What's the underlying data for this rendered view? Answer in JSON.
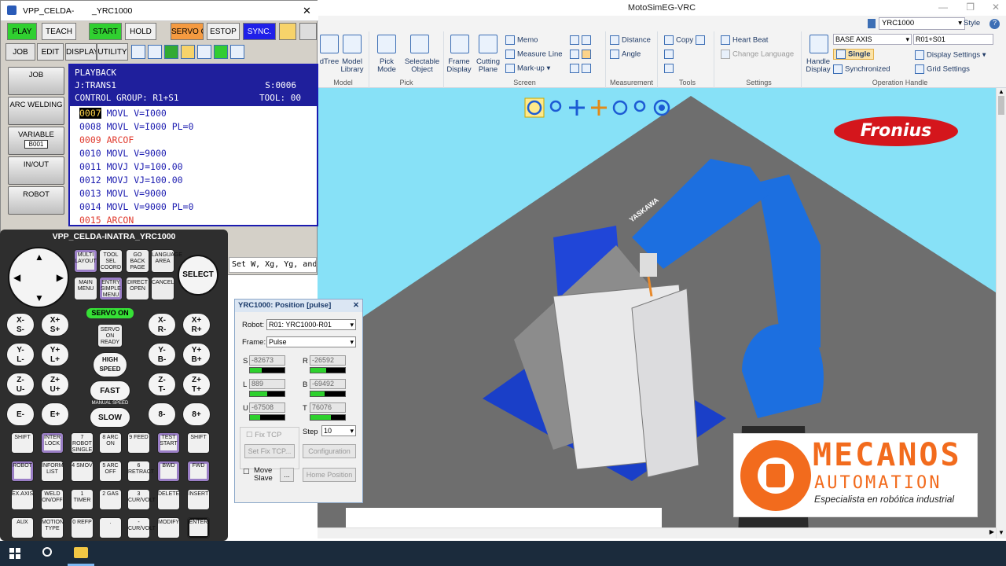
{
  "app": {
    "title": "MotoSimEG-VRC",
    "controller_select": "YRC1000",
    "style_label": "Style",
    "help_label": "?"
  },
  "ribbon": {
    "groups": [
      {
        "name": "Model",
        "items": [
          "dTree",
          "Model Library"
        ]
      },
      {
        "name": "Pick",
        "items": [
          "Pick Mode",
          "Selectable Object"
        ]
      },
      {
        "name": "Screen",
        "items": [
          "Frame Display",
          "Cutting Plane",
          "Memo",
          "Measure Line",
          "Mark-up"
        ]
      },
      {
        "name": "Measurement",
        "items": [
          "Distance",
          "Angle"
        ]
      },
      {
        "name": "Tools",
        "items": [
          "Copy"
        ]
      },
      {
        "name": "Settings",
        "items": [
          "Heart Beat",
          "Change Language"
        ]
      },
      {
        "name": "Operation Handle",
        "items": [
          "Handle Display",
          "BASE AXIS",
          "R01+S01",
          "Single",
          "Display Settings",
          "Synchronized",
          "Grid Settings"
        ]
      }
    ]
  },
  "pendant": {
    "title_left": "VPP_CELDA-",
    "title_right": "_YRC1000",
    "close": "✕",
    "modes": [
      "PLAY",
      "TEACH",
      "START",
      "HOLD",
      "SERVO ON",
      "ESTOP",
      "SYNC."
    ],
    "menu": [
      "JOB",
      "EDIT",
      "DISPLAY",
      "UTILITY"
    ],
    "side": [
      "JOB",
      "ARC WELDING",
      "VARIABLE",
      "IN/OUT",
      "ROBOT"
    ],
    "side_sub": {
      "variable": "B001"
    },
    "screen": {
      "line1": "PLAYBACK",
      "job": "J:TRANS1",
      "step": "S:0006",
      "control_group": "CONTROL GROUP: R1+S1",
      "tool": "TOOL: 00",
      "lines": [
        {
          "num": "0007",
          "text": " MOVL V=I000",
          "color": "blue",
          "selected": true
        },
        {
          "num": "0008",
          "text": " MOVL V=I000 PL=0",
          "color": "blue"
        },
        {
          "num": "0009",
          "text": " ARCOF",
          "color": "red"
        },
        {
          "num": "0010",
          "text": " MOVL V=9000",
          "color": "blue"
        },
        {
          "num": "0011",
          "text": " MOVJ VJ=100.00",
          "color": "blue"
        },
        {
          "num": "0012",
          "text": " MOVJ VJ=100.00",
          "color": "blue"
        },
        {
          "num": "0013",
          "text": " MOVL V=9000",
          "color": "blue"
        },
        {
          "num": "0014",
          "text": " MOVL V=9000 PL=0",
          "color": "blue"
        },
        {
          "num": "0015",
          "text": " ARCON",
          "color": "red"
        }
      ],
      "hint": "Set W, Xg, Yg, and"
    }
  },
  "keypad": {
    "title": "VPP_CELDA-INATRA_YRC1000",
    "select": "SELECT",
    "servo_on": "SERVO ON",
    "top_keys": [
      {
        "sup": "MULTI",
        "label": "LAYOUT"
      },
      {
        "sup": "TOOL SEL",
        "label": "COORD"
      },
      {
        "sup": "GO BACK",
        "label": "PAGE"
      },
      {
        "sup": "LANGUAGE",
        "label": "AREA"
      },
      {
        "sup": "",
        "label": "MAIN MENU"
      },
      {
        "sup": "ENTRY",
        "label": "SIMPLE MENU"
      },
      {
        "sup": "",
        "label": "DIRECT OPEN"
      },
      {
        "sup": "",
        "label": "CANCEL"
      }
    ],
    "left_axes": [
      [
        "X-",
        "S-"
      ],
      [
        "X+",
        "S+"
      ],
      [
        "Y-",
        "L-"
      ],
      [
        "Y+",
        "L+"
      ],
      [
        "Z-",
        "U-"
      ],
      [
        "Z+",
        "U+"
      ],
      [
        "E-",
        ""
      ],
      [
        "E+",
        ""
      ]
    ],
    "right_axes": [
      [
        "X-",
        "R-"
      ],
      [
        "X+",
        "R+"
      ],
      [
        "Y-",
        "B-"
      ],
      [
        "Y+",
        "B+"
      ],
      [
        "Z-",
        "T-"
      ],
      [
        "Z+",
        "T+"
      ],
      [
        "8-",
        ""
      ],
      [
        "8+",
        ""
      ]
    ],
    "center": [
      "SERVO ON READY",
      "HIGH SPEED",
      "FAST",
      "MANUAL SPEED",
      "SLOW"
    ],
    "rows": [
      [
        "SHIFT",
        "INTER LOCK",
        "7 ROBOT SINGLE",
        "8 ARC ON",
        "9 FEED",
        "TEST START",
        "SHIFT"
      ],
      [
        "ROBOT",
        "INFORM LIST",
        "4 SMOV",
        "5 ARC OFF",
        "6 RETRACT",
        "BWD",
        "FWD"
      ],
      [
        "EX.AXIS",
        "WELD ON/OFF",
        "1 TIMER",
        "2 GAS",
        "3 CUR/VOLT",
        "DELETE",
        "INSERT"
      ],
      [
        "AUX",
        "MOTION TYPE",
        "0 REFP",
        ".",
        "- CUR/VOLT",
        "MODIFY",
        "ENTER"
      ]
    ]
  },
  "position_dialog": {
    "title": "YRC1000: Position [pulse]",
    "robot_label": "Robot:",
    "robot_value": "R01: YRC1000-R01",
    "frame_label": "Frame:",
    "frame_value": "Pulse",
    "axes": [
      {
        "name": "S",
        "value": "-82673",
        "fill": 0.35
      },
      {
        "name": "R",
        "value": "-26592",
        "fill": 0.45
      },
      {
        "name": "L",
        "value": "889",
        "fill": 0.5
      },
      {
        "name": "B",
        "value": "-69492",
        "fill": 0.4
      },
      {
        "name": "U",
        "value": "-67508",
        "fill": 0.3
      },
      {
        "name": "T",
        "value": "76076",
        "fill": 0.6
      }
    ],
    "fix_tcp": "Fix TCP",
    "step_label": "Step",
    "step_value": "10",
    "set_fix_tcp": "Set Fix TCP...",
    "configuration": "Configuration",
    "move_slave": "Move Slave",
    "ellipsis": "...",
    "home_position": "Home Position"
  },
  "scene": {
    "brand": "Fronius",
    "robot_label": "YASKAWA"
  },
  "logo": {
    "name": "MECANOS",
    "sub": "AUTOMATION",
    "tagline": "Especialista en robótica industrial"
  },
  "colors": {
    "viewport_bg": "#87e1f7",
    "floor": "#6e6e6e",
    "robot": "#1c6fe0",
    "positioner": "#1a3fc8",
    "logo_orange": "#f26b1d",
    "fronius_red": "#d4161c"
  }
}
